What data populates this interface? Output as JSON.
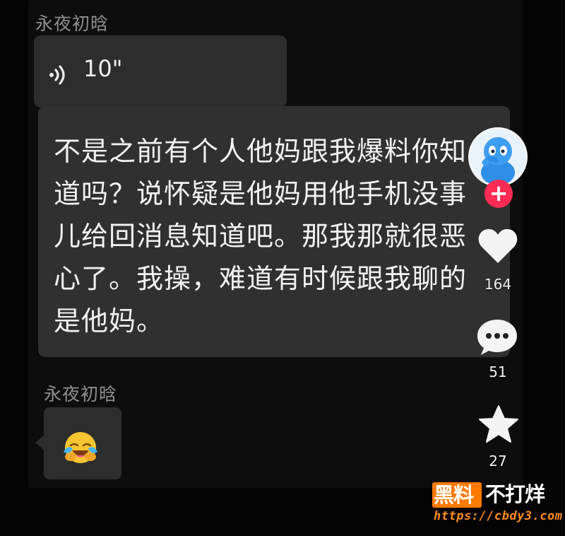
{
  "conversation": {
    "messages": [
      {
        "sender": "永夜初晗",
        "type": "voice",
        "duration": "10\""
      },
      {
        "type": "text",
        "lines": [
          "不是之前有个人他妈跟我爆料你知",
          "道吗？说怀疑是他妈用他手机没事",
          "儿给回消息知道吧。那我那就很恶",
          "心了。我操，难道有时候跟我聊的",
          "是他妈。"
        ]
      },
      {
        "sender": "永夜初晗",
        "type": "emoji",
        "emoji": "😭"
      }
    ]
  },
  "action_rail": {
    "avatar": "avatar",
    "follow_symbol": "+",
    "like": {
      "icon": "heart-icon",
      "count": "164"
    },
    "comment": {
      "icon": "comment-icon",
      "count": "51"
    },
    "favorite": {
      "icon": "star-icon",
      "count": "27"
    }
  },
  "watermark": {
    "logo": "黑料",
    "tagline": "不打烊",
    "url": "https://cbdy3.com"
  },
  "colors": {
    "chat_background": "#0d0d0d",
    "bubble": "#2d2d2d",
    "accent_red": "#fe2c55",
    "watermark_orange": "#ff7a00"
  }
}
